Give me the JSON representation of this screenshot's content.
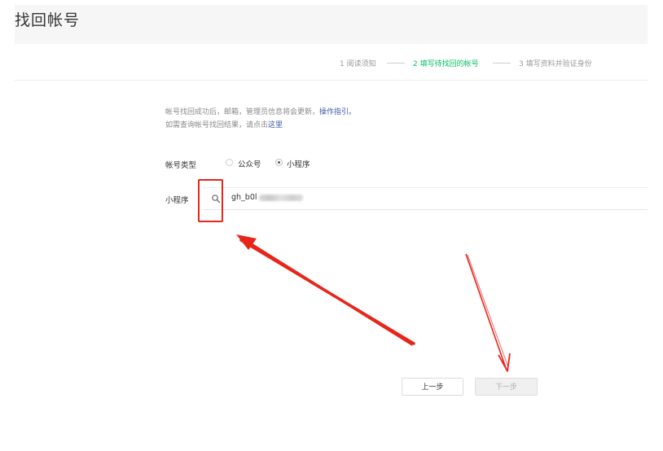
{
  "page": {
    "title": "找回帐号"
  },
  "steps": [
    {
      "label": "1 阅读须知",
      "state": "done"
    },
    {
      "label": "2 填写待找回的帐号",
      "state": "active"
    },
    {
      "label": "3 填写资料并验证身份",
      "state": "pending"
    }
  ],
  "notice": {
    "line1_text": "帐号找回成功后，邮箱，管理员信息将会更新，",
    "line1_link": "操作指引。",
    "line2_text": "如需查询帐号找回结果，请点击",
    "line2_link": "这里"
  },
  "account_type": {
    "label": "帐号类型",
    "options": [
      {
        "label": "公众号",
        "checked": false
      },
      {
        "label": "小程序",
        "checked": true
      }
    ]
  },
  "search": {
    "label": "小程序",
    "value": "gh_b0l",
    "icon": "search-icon"
  },
  "buttons": {
    "prev": "上一步",
    "next": "下一步",
    "next_disabled": true
  },
  "colors": {
    "accent": "#07c160",
    "link": "#3b5ba5",
    "annotation": "#e8251b"
  }
}
